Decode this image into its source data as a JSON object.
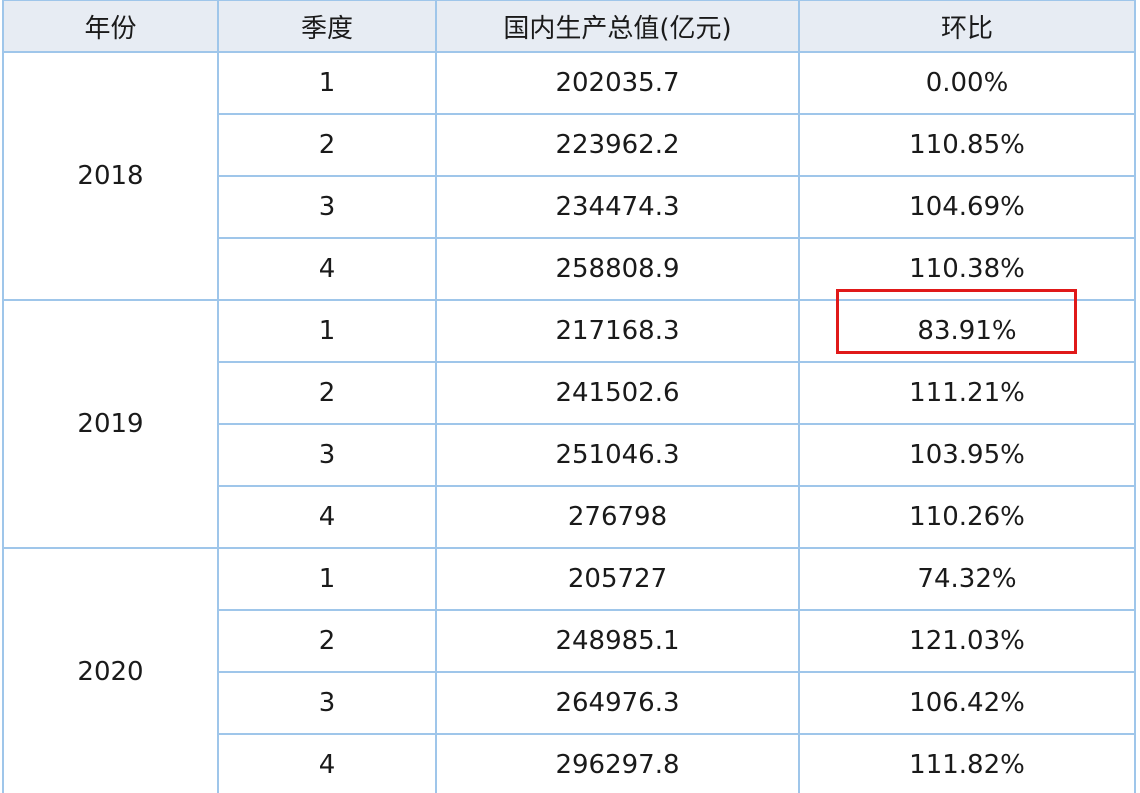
{
  "table": {
    "headers": [
      "年份",
      "季度",
      "国内生产总值(亿元)",
      "环比"
    ],
    "groups": [
      {
        "year": "2018",
        "rows": [
          {
            "quarter": "1",
            "gdp": "202035.7",
            "ratio": "0.00%"
          },
          {
            "quarter": "2",
            "gdp": "223962.2",
            "ratio": "110.85%"
          },
          {
            "quarter": "3",
            "gdp": "234474.3",
            "ratio": "104.69%"
          },
          {
            "quarter": "4",
            "gdp": "258808.9",
            "ratio": "110.38%"
          }
        ]
      },
      {
        "year": "2019",
        "rows": [
          {
            "quarter": "1",
            "gdp": "217168.3",
            "ratio": "83.91%"
          },
          {
            "quarter": "2",
            "gdp": "241502.6",
            "ratio": "111.21%"
          },
          {
            "quarter": "3",
            "gdp": "251046.3",
            "ratio": "103.95%"
          },
          {
            "quarter": "4",
            "gdp": "276798",
            "ratio": "110.26%"
          }
        ]
      },
      {
        "year": "2020",
        "rows": [
          {
            "quarter": "1",
            "gdp": "205727",
            "ratio": "74.32%"
          },
          {
            "quarter": "2",
            "gdp": "248985.1",
            "ratio": "121.03%"
          },
          {
            "quarter": "3",
            "gdp": "264976.3",
            "ratio": "106.42%"
          },
          {
            "quarter": "4",
            "gdp": "296297.8",
            "ratio": "111.82%"
          }
        ]
      }
    ]
  },
  "colors": {
    "header_bg": "#e7ecf3",
    "border": "#9fc6ea",
    "gdp_fill": "#00ff00",
    "ratio_fill": "#ffff00",
    "highlight_border": "#e01919"
  }
}
